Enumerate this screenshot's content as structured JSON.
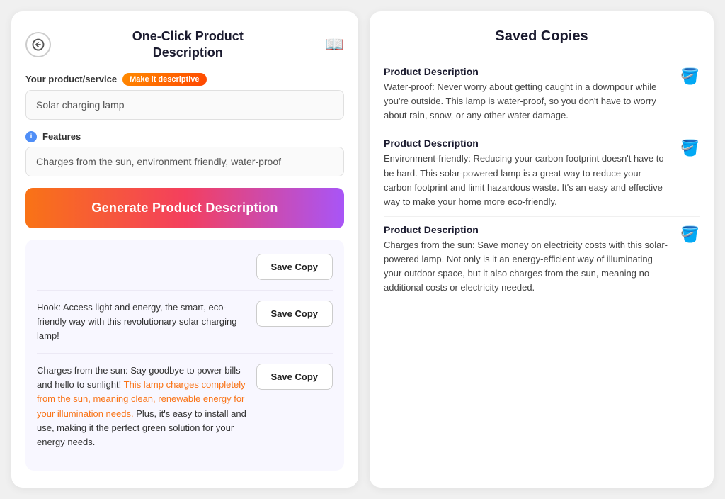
{
  "header": {
    "title": "One-Click Product\nDescription",
    "back_label": "←",
    "book_icon": "📖"
  },
  "form": {
    "product_label": "Your product/service",
    "make_descriptive_label": "Make it descriptive",
    "product_placeholder": "Solar charging lamp",
    "product_value": "Solar charging lamp",
    "features_label": "Features",
    "features_info": "i",
    "features_placeholder": "Charges from the sun, environment friendly, water-proof",
    "features_value": "Charges from the sun, environment friendly, water-proof",
    "generate_button": "Generate Product Description"
  },
  "results": {
    "rows": [
      {
        "id": "row-top",
        "text": "",
        "save_label": "Save Copy"
      },
      {
        "id": "row-1",
        "text": "Hook: Access light and energy, the smart, eco-friendly way with this revolutionary solar charging lamp!",
        "save_label": "Save Copy"
      },
      {
        "id": "row-2",
        "text": "Charges from the sun: Say goodbye to power bills and hello to sunlight! This lamp charges completely from the sun, meaning clean, renewable energy for your illumination needs. Plus, it's easy to install and use, making it the perfect green solution for your energy needs.",
        "save_label": "Save Copy"
      }
    ]
  },
  "saved_copies": {
    "title": "Saved Copies",
    "trash_icon": "🗑️",
    "items": [
      {
        "title": "Product Description",
        "text": "Water-proof: Never worry about getting caught in a downpour while you're outside. This lamp is water-proof, so you don't have to worry about rain, snow, or any other water damage."
      },
      {
        "title": "Product Description",
        "text": "Environment-friendly: Reducing your carbon footprint doesn't have to be hard. This solar-powered lamp is a great way to reduce your carbon footprint and limit hazardous waste. It's an easy and effective way to make your home more eco-friendly."
      },
      {
        "title": "Product Description",
        "text": "Charges from the sun: Save money on electricity costs with this solar-powered lamp. Not only is it an energy-efficient way of illuminating your outdoor space, but it also charges from the sun, meaning no additional costs or electricity needed."
      }
    ]
  }
}
